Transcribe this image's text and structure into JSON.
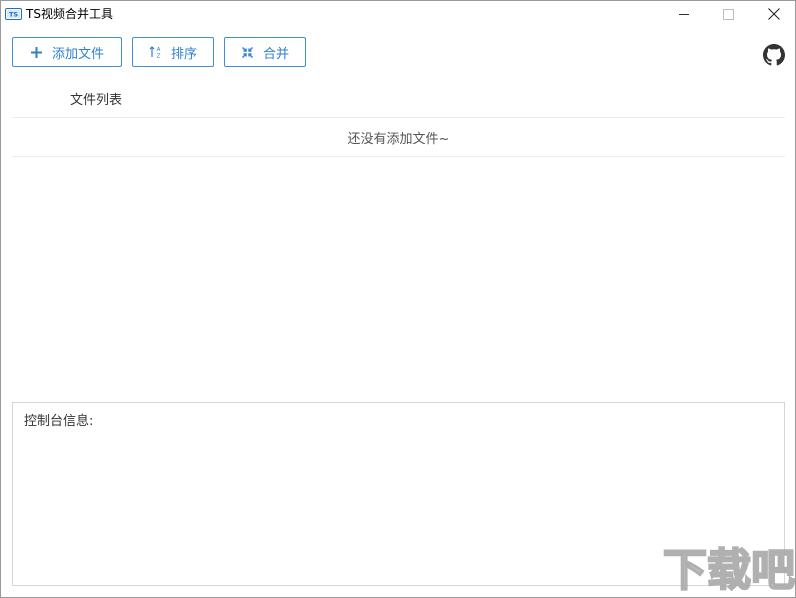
{
  "window": {
    "title": "TS视频合并工具",
    "icons": {
      "app": "app-icon",
      "minimize": "minimize-icon",
      "maximize": "maximize-icon",
      "close": "close-icon"
    }
  },
  "toolbar": {
    "add_label": "添加文件",
    "add_icon": "plus-icon",
    "sort_label": "排序",
    "sort_icon": "sort-icon",
    "merge_label": "合并",
    "merge_icon": "merge-icon",
    "github_icon": "github-icon",
    "accent_color": "#2f7fcf"
  },
  "file_list": {
    "header": "文件列表",
    "empty_text": "还没有添加文件~"
  },
  "console": {
    "label": "控制台信息:"
  },
  "watermark": {
    "text": "下载吧"
  }
}
